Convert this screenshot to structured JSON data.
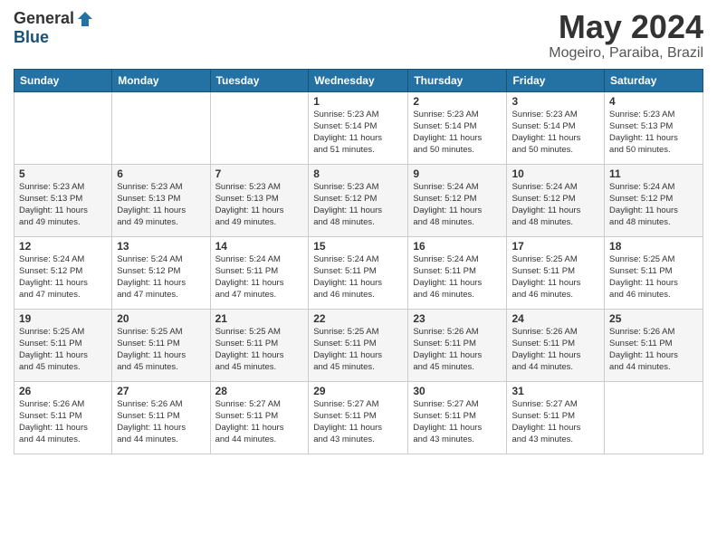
{
  "header": {
    "logo_general": "General",
    "logo_blue": "Blue",
    "month_title": "May 2024",
    "location": "Mogeiro, Paraiba, Brazil"
  },
  "weekdays": [
    "Sunday",
    "Monday",
    "Tuesday",
    "Wednesday",
    "Thursday",
    "Friday",
    "Saturday"
  ],
  "weeks": [
    {
      "days": [
        {
          "number": "",
          "info": ""
        },
        {
          "number": "",
          "info": ""
        },
        {
          "number": "",
          "info": ""
        },
        {
          "number": "1",
          "info": "Sunrise: 5:23 AM\nSunset: 5:14 PM\nDaylight: 11 hours\nand 51 minutes."
        },
        {
          "number": "2",
          "info": "Sunrise: 5:23 AM\nSunset: 5:14 PM\nDaylight: 11 hours\nand 50 minutes."
        },
        {
          "number": "3",
          "info": "Sunrise: 5:23 AM\nSunset: 5:14 PM\nDaylight: 11 hours\nand 50 minutes."
        },
        {
          "number": "4",
          "info": "Sunrise: 5:23 AM\nSunset: 5:13 PM\nDaylight: 11 hours\nand 50 minutes."
        }
      ]
    },
    {
      "days": [
        {
          "number": "5",
          "info": "Sunrise: 5:23 AM\nSunset: 5:13 PM\nDaylight: 11 hours\nand 49 minutes."
        },
        {
          "number": "6",
          "info": "Sunrise: 5:23 AM\nSunset: 5:13 PM\nDaylight: 11 hours\nand 49 minutes."
        },
        {
          "number": "7",
          "info": "Sunrise: 5:23 AM\nSunset: 5:13 PM\nDaylight: 11 hours\nand 49 minutes."
        },
        {
          "number": "8",
          "info": "Sunrise: 5:23 AM\nSunset: 5:12 PM\nDaylight: 11 hours\nand 48 minutes."
        },
        {
          "number": "9",
          "info": "Sunrise: 5:24 AM\nSunset: 5:12 PM\nDaylight: 11 hours\nand 48 minutes."
        },
        {
          "number": "10",
          "info": "Sunrise: 5:24 AM\nSunset: 5:12 PM\nDaylight: 11 hours\nand 48 minutes."
        },
        {
          "number": "11",
          "info": "Sunrise: 5:24 AM\nSunset: 5:12 PM\nDaylight: 11 hours\nand 48 minutes."
        }
      ]
    },
    {
      "days": [
        {
          "number": "12",
          "info": "Sunrise: 5:24 AM\nSunset: 5:12 PM\nDaylight: 11 hours\nand 47 minutes."
        },
        {
          "number": "13",
          "info": "Sunrise: 5:24 AM\nSunset: 5:12 PM\nDaylight: 11 hours\nand 47 minutes."
        },
        {
          "number": "14",
          "info": "Sunrise: 5:24 AM\nSunset: 5:11 PM\nDaylight: 11 hours\nand 47 minutes."
        },
        {
          "number": "15",
          "info": "Sunrise: 5:24 AM\nSunset: 5:11 PM\nDaylight: 11 hours\nand 46 minutes."
        },
        {
          "number": "16",
          "info": "Sunrise: 5:24 AM\nSunset: 5:11 PM\nDaylight: 11 hours\nand 46 minutes."
        },
        {
          "number": "17",
          "info": "Sunrise: 5:25 AM\nSunset: 5:11 PM\nDaylight: 11 hours\nand 46 minutes."
        },
        {
          "number": "18",
          "info": "Sunrise: 5:25 AM\nSunset: 5:11 PM\nDaylight: 11 hours\nand 46 minutes."
        }
      ]
    },
    {
      "days": [
        {
          "number": "19",
          "info": "Sunrise: 5:25 AM\nSunset: 5:11 PM\nDaylight: 11 hours\nand 45 minutes."
        },
        {
          "number": "20",
          "info": "Sunrise: 5:25 AM\nSunset: 5:11 PM\nDaylight: 11 hours\nand 45 minutes."
        },
        {
          "number": "21",
          "info": "Sunrise: 5:25 AM\nSunset: 5:11 PM\nDaylight: 11 hours\nand 45 minutes."
        },
        {
          "number": "22",
          "info": "Sunrise: 5:25 AM\nSunset: 5:11 PM\nDaylight: 11 hours\nand 45 minutes."
        },
        {
          "number": "23",
          "info": "Sunrise: 5:26 AM\nSunset: 5:11 PM\nDaylight: 11 hours\nand 45 minutes."
        },
        {
          "number": "24",
          "info": "Sunrise: 5:26 AM\nSunset: 5:11 PM\nDaylight: 11 hours\nand 44 minutes."
        },
        {
          "number": "25",
          "info": "Sunrise: 5:26 AM\nSunset: 5:11 PM\nDaylight: 11 hours\nand 44 minutes."
        }
      ]
    },
    {
      "days": [
        {
          "number": "26",
          "info": "Sunrise: 5:26 AM\nSunset: 5:11 PM\nDaylight: 11 hours\nand 44 minutes."
        },
        {
          "number": "27",
          "info": "Sunrise: 5:26 AM\nSunset: 5:11 PM\nDaylight: 11 hours\nand 44 minutes."
        },
        {
          "number": "28",
          "info": "Sunrise: 5:27 AM\nSunset: 5:11 PM\nDaylight: 11 hours\nand 44 minutes."
        },
        {
          "number": "29",
          "info": "Sunrise: 5:27 AM\nSunset: 5:11 PM\nDaylight: 11 hours\nand 43 minutes."
        },
        {
          "number": "30",
          "info": "Sunrise: 5:27 AM\nSunset: 5:11 PM\nDaylight: 11 hours\nand 43 minutes."
        },
        {
          "number": "31",
          "info": "Sunrise: 5:27 AM\nSunset: 5:11 PM\nDaylight: 11 hours\nand 43 minutes."
        },
        {
          "number": "",
          "info": ""
        }
      ]
    }
  ]
}
